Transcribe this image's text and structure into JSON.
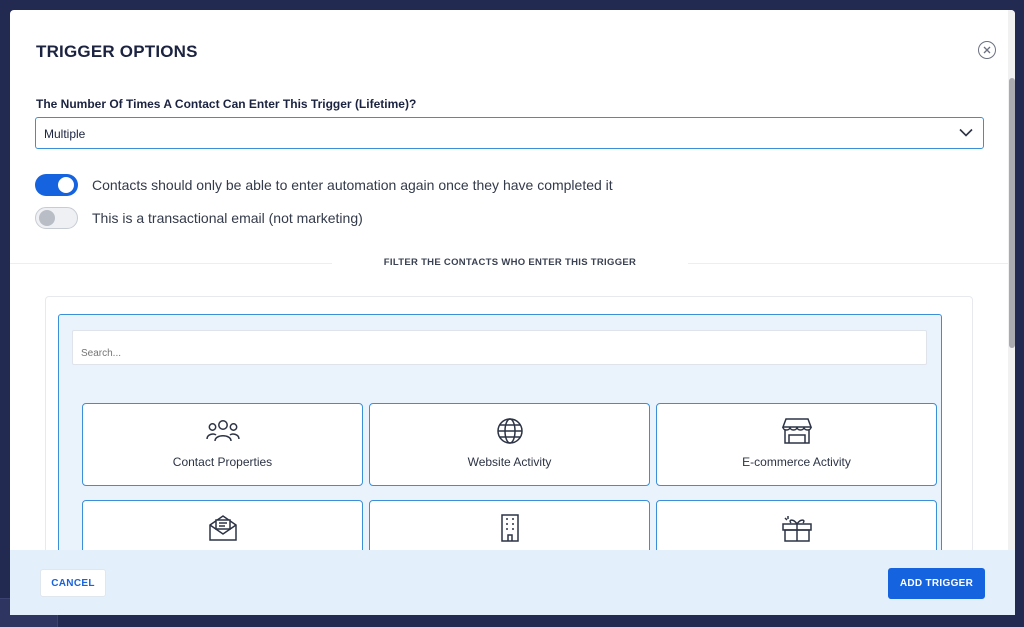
{
  "modal": {
    "title": "TRIGGER OPTIONS"
  },
  "entry_limit": {
    "label": "The Number Of Times A Contact Can Enter This Trigger (Lifetime)?",
    "selected": "Multiple"
  },
  "toggles": [
    {
      "label": "Contacts should only be able to enter automation again once they have completed it",
      "on": true
    },
    {
      "label": "This is a transactional email (not marketing)",
      "on": false
    }
  ],
  "filter": {
    "title": "FILTER THE CONTACTS WHO ENTER THIS TRIGGER",
    "search_placeholder": "Search...",
    "categories": [
      {
        "label": "Contact Properties",
        "icon": "users-icon"
      },
      {
        "label": "Website Activity",
        "icon": "globe-icon"
      },
      {
        "label": "E-commerce Activity",
        "icon": "storefront-icon"
      },
      {
        "label": "",
        "icon": "envelope-open-icon"
      },
      {
        "label": "",
        "icon": "building-icon"
      },
      {
        "label": "",
        "icon": "gift-icon"
      }
    ]
  },
  "footer": {
    "cancel_label": "CANCEL",
    "add_label": "ADD TRIGGER"
  },
  "colors": {
    "accent": "#1663e0",
    "border_blue": "#3b8fd9",
    "footer_bg": "#e3f0fc",
    "backdrop": "#232a52"
  }
}
